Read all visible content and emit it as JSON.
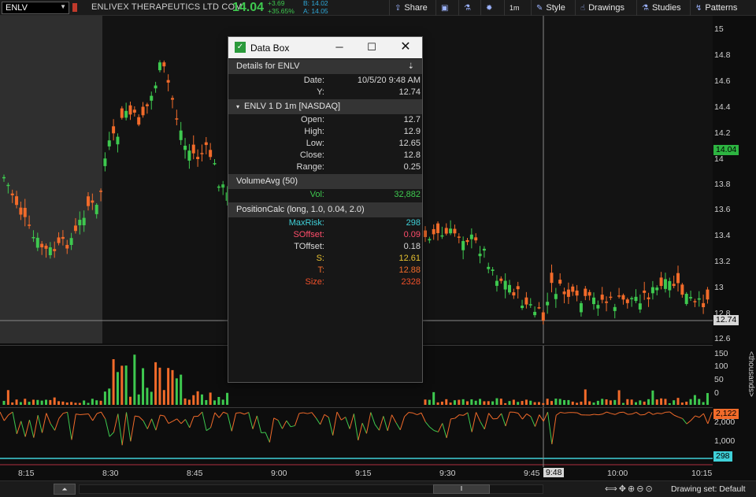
{
  "toolbar": {
    "symbol": "ENLV",
    "company": "ENLIVEX THERAPEUTICS LTD COM",
    "last": "14.04",
    "change_abs": "+3.69",
    "change_pct": "+35.65%",
    "bid": "B: 14.02",
    "ask": "A: 14.05",
    "share_label": "Share",
    "interval_label": "1m",
    "style_label": "Style",
    "drawings_label": "Drawings",
    "studies_label": "Studies",
    "patterns_label": "Patterns"
  },
  "colors": {
    "up": "#3ec94f",
    "down": "#f26b2a",
    "cyan": "#3fd0d8",
    "pink": "#ff4d6a",
    "gold": "#e6c030"
  },
  "price_axis": {
    "ticks": [
      "15",
      "14.8",
      "14.6",
      "14.4",
      "14.2",
      "14",
      "13.8",
      "13.6",
      "13.4",
      "13.2",
      "13",
      "12.8",
      "12.6"
    ],
    "last_label": "14.04",
    "cursor_label": "12.74"
  },
  "volume_axis": {
    "ticks": [
      "150",
      "100",
      "50",
      "0"
    ],
    "unit": "<thousands>"
  },
  "indicator_axis": {
    "ticks": [
      "2,000",
      "1,000"
    ],
    "value_label": "2,122",
    "line_label": "298"
  },
  "time_axis": {
    "ticks": [
      "8:15",
      "8:30",
      "8:45",
      "9:00",
      "9:15",
      "9:30",
      "9:45",
      "10:00",
      "10:15"
    ],
    "cursor_label": "9:48"
  },
  "bottom": {
    "drawing_set": "Drawing set: Default"
  },
  "databox": {
    "title": "Data Box",
    "details_header": "Details for ENLV",
    "date_label": "Date:",
    "date_value": "10/5/20 9:48 AM",
    "y_label": "Y:",
    "y_value": "12.74",
    "ohlc_header": "ENLV 1 D 1m [NASDAQ]",
    "open_label": "Open:",
    "open_value": "12.7",
    "high_label": "High:",
    "high_value": "12.9",
    "low_label": "Low:",
    "low_value": "12.65",
    "close_label": "Close:",
    "close_value": "12.8",
    "range_label": "Range:",
    "range_value": "0.25",
    "vol_header": "VolumeAvg (50)",
    "vol_label": "Vol:",
    "vol_value": "32,882",
    "pos_header": "PositionCalc (long, 1.0, 0.04, 2.0)",
    "maxrisk_label": "MaxRisk:",
    "maxrisk_value": "298",
    "soffset_label": "SOffset:",
    "soffset_value": "0.09",
    "toffset_label": "TOffset:",
    "toffset_value": "0.18",
    "s_label": "S:",
    "s_value": "12.61",
    "t_label": "T:",
    "t_value": "12.88",
    "size_label": "Size:",
    "size_value": "2328"
  }
}
